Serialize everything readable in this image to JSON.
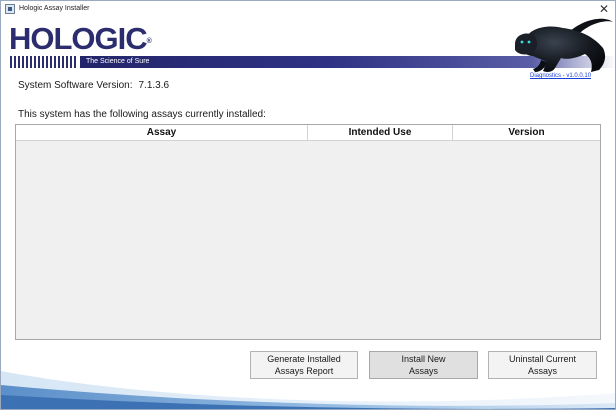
{
  "window": {
    "title": "Hologic Assay Installer",
    "close_glyph": "✕"
  },
  "header": {
    "logo_text": "HOLOGIC",
    "logo_mark": "®",
    "tagline": "The Science of Sure",
    "diagnostics_link": "Diagnostics - v1.0.0.10"
  },
  "system": {
    "software_label": "System Software Version:",
    "software_version": "7.1.3.6",
    "installed_label": "This system has the following assays currently installed:"
  },
  "table": {
    "columns": [
      "Assay",
      "Intended Use",
      "Version"
    ],
    "rows": []
  },
  "actions": {
    "report_label": "Generate Installed\nAssays Report",
    "install_label": "Install New\nAssays",
    "uninstall_label": "Uninstall Current\nAssays"
  },
  "colors": {
    "brand_navy": "#2b2d6e",
    "link_blue": "#1a3fd6"
  },
  "icons": {
    "app": "app-window-icon",
    "close": "close-icon",
    "mascot": "panther-image"
  }
}
